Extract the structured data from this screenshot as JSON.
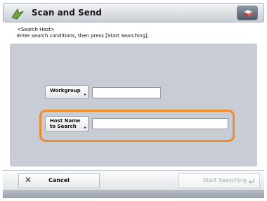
{
  "header": {
    "title": "Scan and Send",
    "app_icon": "scan-send-icon",
    "status_icon": "status-monitor-icon"
  },
  "instructions": {
    "line1": "<Search Host>",
    "line2": "Enter search conditions, then press [Start Searching]."
  },
  "form": {
    "workgroup": {
      "label": "Workgroup",
      "value": ""
    },
    "host_name": {
      "label_line1": "Host Name",
      "label_line2": "to Search",
      "value": ""
    }
  },
  "footer": {
    "cancel_label": "Cancel",
    "start_label": "Start Searching"
  },
  "colors": {
    "highlight": "#f28c28",
    "panel": "#c7ccd5"
  }
}
